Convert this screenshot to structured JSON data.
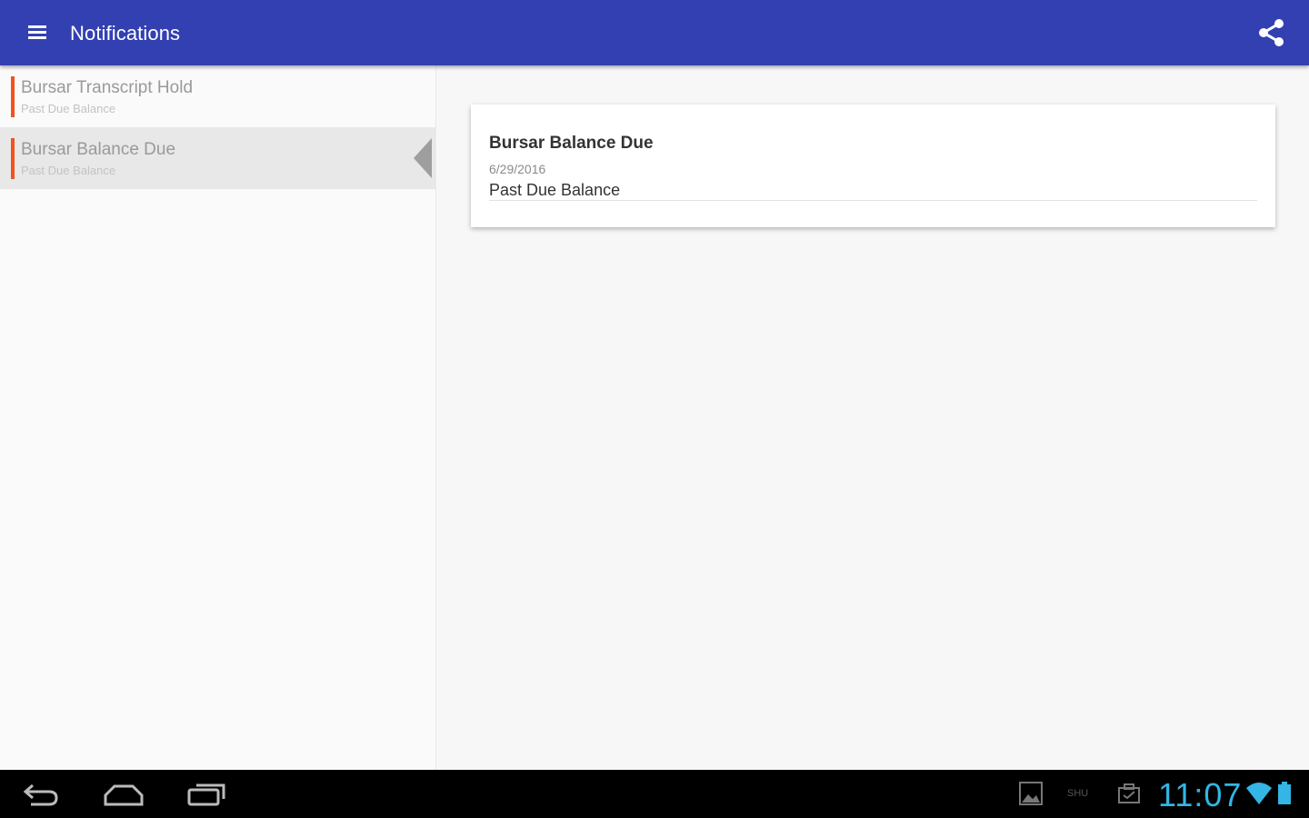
{
  "app_bar": {
    "title": "Notifications",
    "menu_icon": "hamburger-menu-icon",
    "share_icon": "share-icon",
    "background_color": "#3340b2"
  },
  "notifications": {
    "accent_color": "#f0531f",
    "items": [
      {
        "title": "Bursar Transcript Hold",
        "subtitle": "Past Due Balance",
        "selected": false
      },
      {
        "title": "Bursar Balance Due",
        "subtitle": "Past Due Balance",
        "selected": true
      }
    ]
  },
  "detail": {
    "title": "Bursar Balance Due",
    "date": "6/29/2016",
    "body": "Past Due Balance"
  },
  "system_bar": {
    "clock": "11:07",
    "status_text": "SHU",
    "clock_color": "#33b5e5",
    "icons": [
      "back-icon",
      "home-icon",
      "recent-apps-icon",
      "gallery-notification-icon",
      "briefcase-notification-icon",
      "wifi-icon",
      "battery-icon"
    ]
  }
}
